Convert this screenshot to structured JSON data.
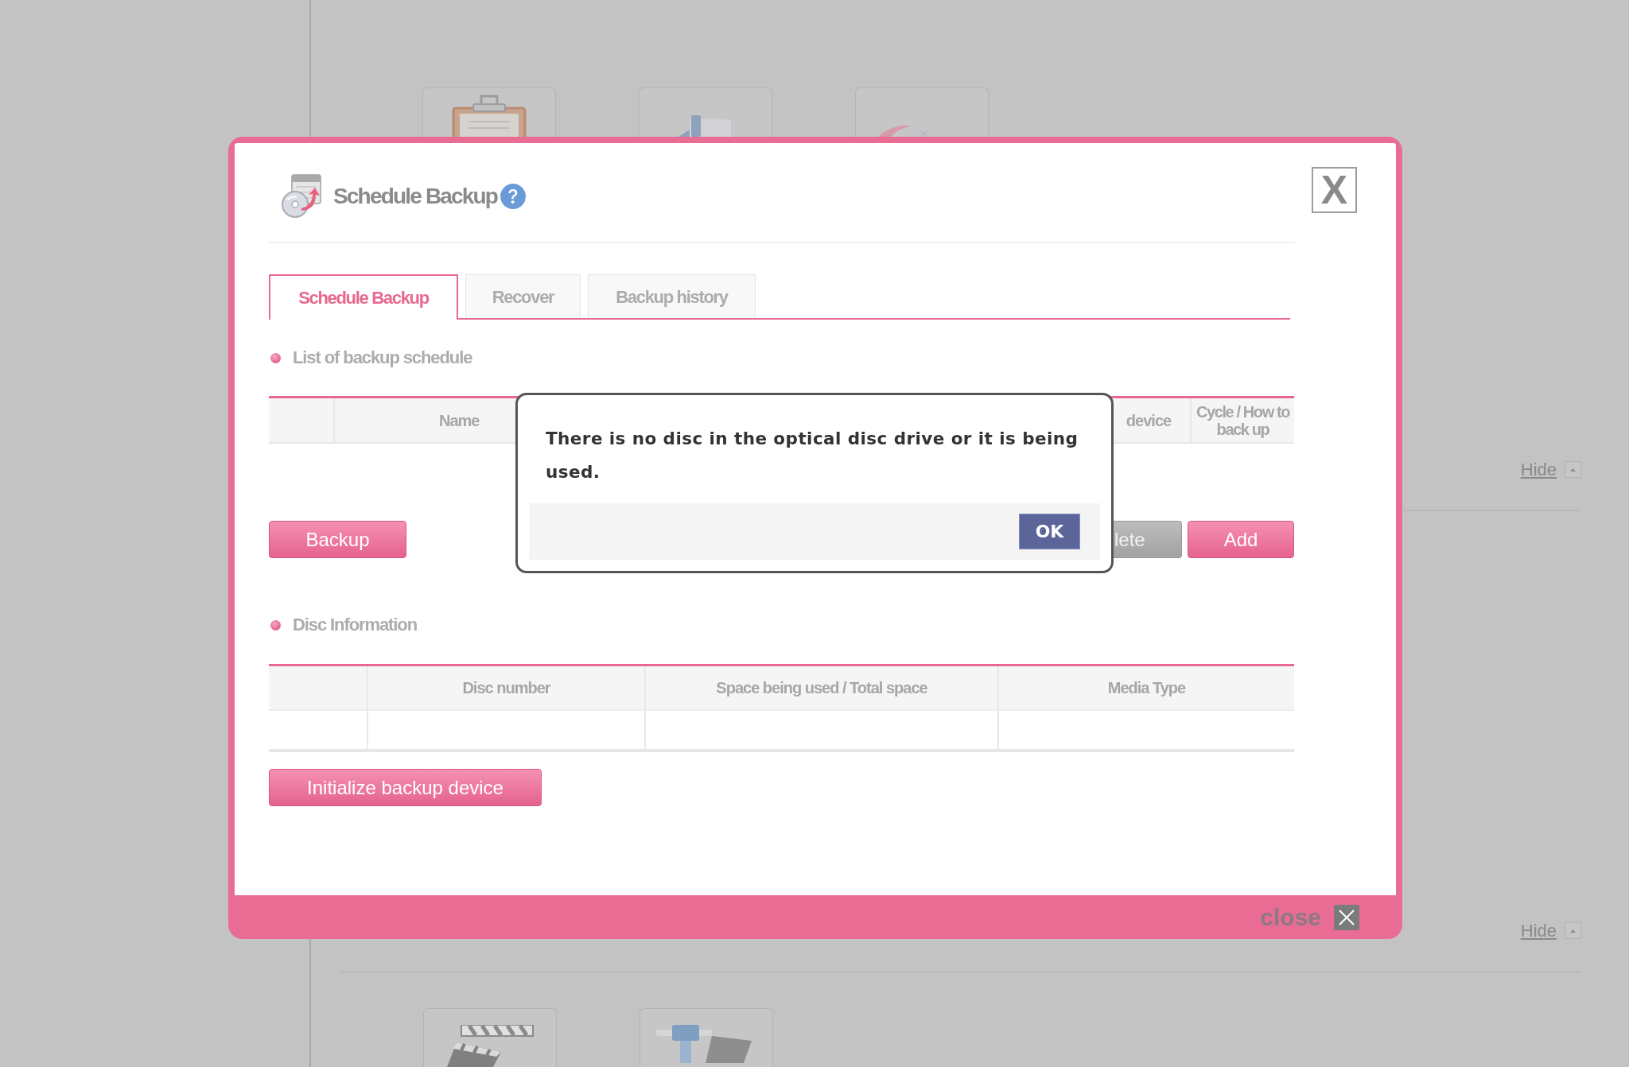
{
  "page": {
    "top_tiles": [
      {
        "kind": "clipboard"
      },
      {
        "kind": "panel"
      },
      {
        "kind": "swoosh"
      }
    ],
    "hide_links": [
      "Hide",
      "Hide"
    ],
    "bottom_tiles": [
      {
        "kind": "clapperboard"
      },
      {
        "kind": "pipe"
      }
    ]
  },
  "dialog": {
    "title": "Schedule Backup",
    "close_button": "X",
    "tabs": [
      {
        "label": "Schedule Backup",
        "selected": true
      },
      {
        "label": "Recover",
        "selected": false
      },
      {
        "label": "Backup history",
        "selected": false
      }
    ],
    "schedule_list": {
      "heading": "List of backup schedule",
      "columns": [
        "Name",
        "device",
        "Cycle / How to back up"
      ],
      "buttons": [
        {
          "label": "Backup",
          "kind": "primary"
        },
        {
          "label": "lete",
          "kind": "secondary"
        },
        {
          "label": "Add",
          "kind": "primary"
        }
      ]
    },
    "disc_information": {
      "heading": "Disc Information",
      "columns": [
        "Disc number",
        "Space being used / Total space",
        "Media Type"
      ],
      "buttons": [
        {
          "label": "Initialize backup device",
          "kind": "primary"
        }
      ]
    },
    "footer": {
      "close_label": "close"
    }
  },
  "alert": {
    "message": "There is no disc in the optical disc drive or it is being used.",
    "button": "OK"
  }
}
